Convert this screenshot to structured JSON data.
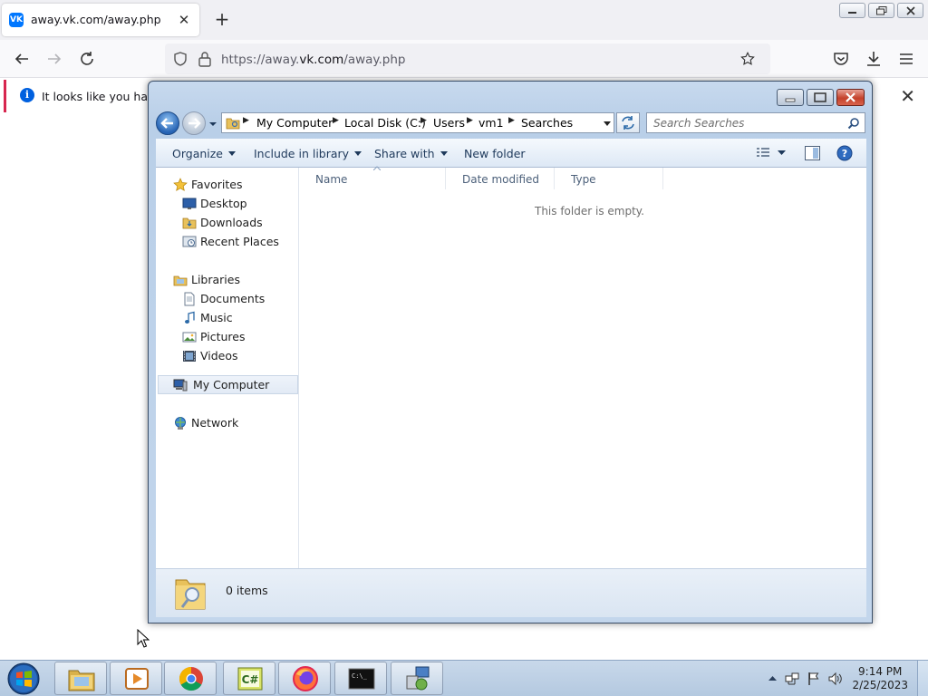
{
  "browser": {
    "tab_title": "away.vk.com/away.php",
    "favicon_text": "VK",
    "url_prefix": "https://away.",
    "url_domain": "vk.com",
    "url_path": "/away.php",
    "notification_text": "It looks like you haven't"
  },
  "explorer": {
    "breadcrumb": [
      "My Computer",
      "Local Disk (C:)",
      "Users",
      "vm1",
      "Searches"
    ],
    "search_placeholder": "Search Searches",
    "toolbar": {
      "organize": "Organize",
      "include_in_library": "Include in library",
      "share_with": "Share with",
      "new_folder": "New folder"
    },
    "nav_pane": {
      "favorites": "Favorites",
      "favorites_items": [
        "Desktop",
        "Downloads",
        "Recent Places"
      ],
      "libraries": "Libraries",
      "libraries_items": [
        "Documents",
        "Music",
        "Pictures",
        "Videos"
      ],
      "computer": "My Computer",
      "network": "Network"
    },
    "columns": [
      "Name",
      "Date modified",
      "Type"
    ],
    "empty_message": "This folder is empty.",
    "status_count": "0 items"
  },
  "taskbar": {
    "cmd_label": "C:\\_",
    "csharp_label": "C#",
    "time": "9:14 PM",
    "date": "2/25/2023"
  }
}
